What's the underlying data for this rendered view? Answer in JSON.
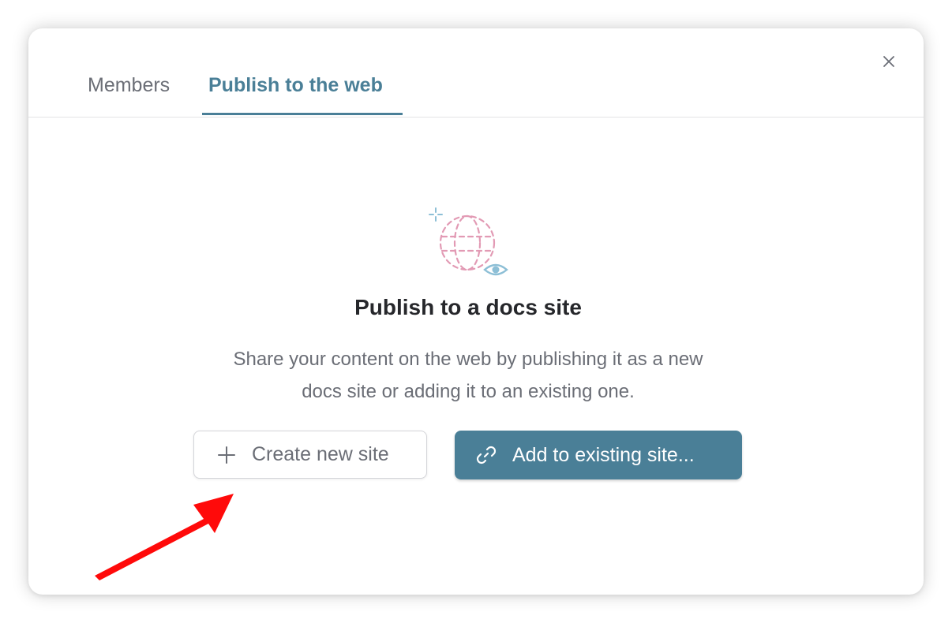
{
  "tabs": [
    {
      "label": "Members",
      "active": false
    },
    {
      "label": "Publish to the web",
      "active": true
    }
  ],
  "publish": {
    "heading": "Publish to a docs site",
    "description": "Share your content on the web by publishing it as a new docs site or adding it to an existing one.",
    "illustration_icon": "globe-with-eye-icon",
    "create_button": {
      "label": "Create new site",
      "icon": "plus-icon"
    },
    "add_button": {
      "label": "Add to existing site...",
      "icon": "link-icon"
    }
  },
  "close_icon": "close-icon",
  "annotation": {
    "icon": "red-arrow-icon",
    "color": "#ff0a0a"
  },
  "colors": {
    "accent": "#4a7f97",
    "text_muted": "#6b6e76",
    "heading": "#26272b",
    "globe_pink": "#e29ab4",
    "eye_blue": "#8dbfd6"
  }
}
